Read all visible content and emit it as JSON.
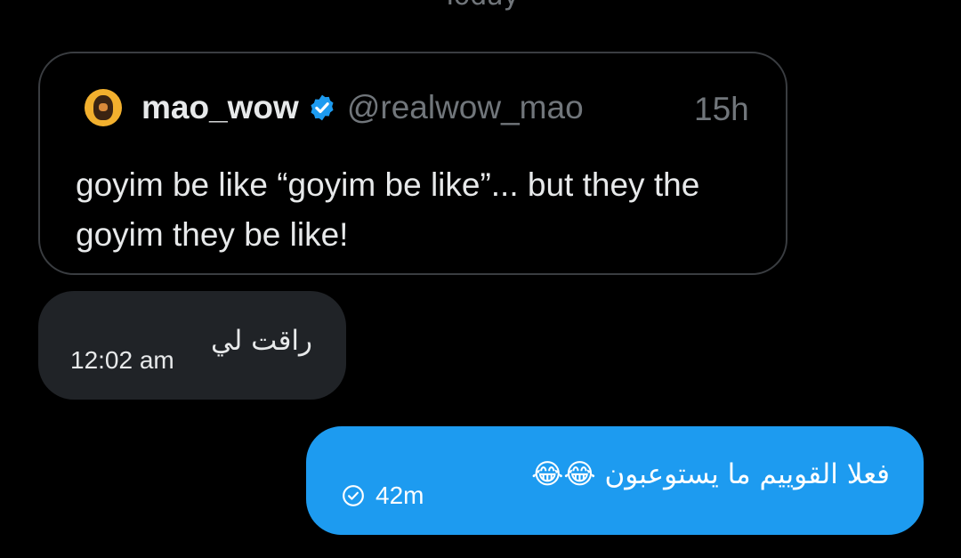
{
  "divider": {
    "label": "Today"
  },
  "quoted_post": {
    "display_name": "mao_wow",
    "handle": "@realwow_mao",
    "time": "15h",
    "text": "goyim be like “goyim be like”... but they the goyim they be like!",
    "verified_icon": "verified-badge-icon",
    "avatar_icon": "avatar-portrait"
  },
  "messages": [
    {
      "direction": "received",
      "text": "راقت لي",
      "time": "12:02 am"
    },
    {
      "direction": "sent",
      "text": "فعلا القوييم ما يستوعبون 😂😂",
      "time": "42m",
      "status_icon": "seen-check-icon"
    }
  ],
  "colors": {
    "background": "#000000",
    "received_bubble": "#202327",
    "sent_bubble": "#1d9bf0",
    "muted_text": "#71767b",
    "verified": "#1d9bf0"
  }
}
